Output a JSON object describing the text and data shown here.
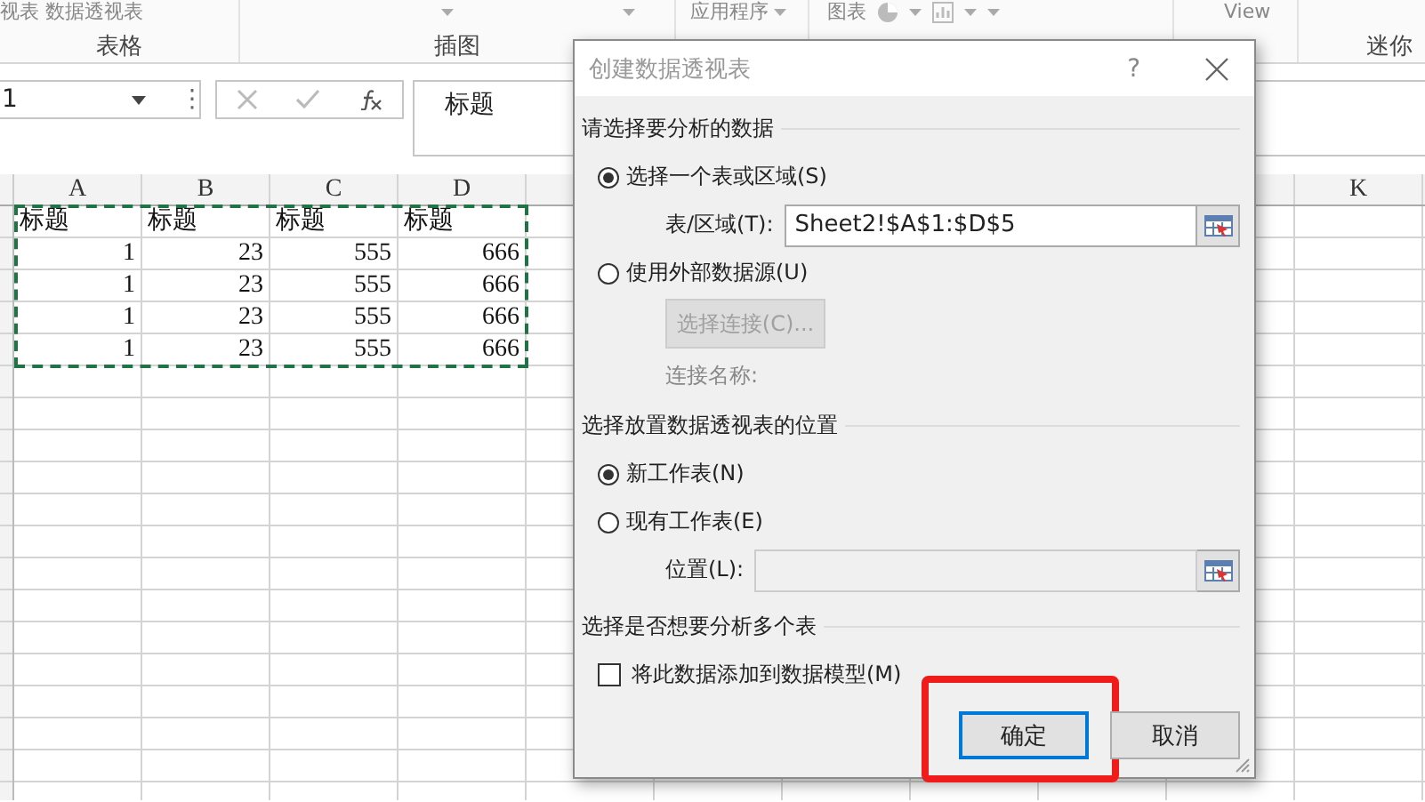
{
  "ribbon": {
    "groups": [
      {
        "label": "表格",
        "tools": [
          {
            "kind": "text",
            "text": "视表 数据透视表"
          }
        ]
      },
      {
        "label": "插图",
        "tools": [
          {
            "kind": "caret"
          },
          {
            "kind": "caret"
          }
        ]
      },
      {
        "tools": [
          {
            "kind": "text",
            "text": "应用程序"
          },
          {
            "kind": "caret"
          }
        ]
      },
      {
        "tools": [
          {
            "kind": "text",
            "text": "图表"
          },
          {
            "kind": "pie"
          },
          {
            "kind": "caret"
          },
          {
            "kind": "chart"
          },
          {
            "kind": "caret"
          },
          {
            "kind": "caret"
          }
        ]
      },
      {
        "tools": [
          {
            "kind": "text",
            "text": "View"
          }
        ]
      },
      {
        "label": "迷你"
      }
    ]
  },
  "formula_bar": {
    "name_box": "1",
    "more": "⋮",
    "formula": "标题"
  },
  "sheet": {
    "columns_left": [
      "A",
      "B",
      "C",
      "D"
    ],
    "columns_right": [
      "K"
    ],
    "copy_marquee": true,
    "rows": [
      {
        "kind": "text",
        "cells": [
          "标题",
          "标题",
          "标题",
          "标题"
        ]
      },
      {
        "kind": "number",
        "cells": [
          "1",
          "23",
          "555",
          "666"
        ]
      },
      {
        "kind": "number",
        "cells": [
          "1",
          "23",
          "555",
          "666"
        ]
      },
      {
        "kind": "number",
        "cells": [
          "1",
          "23",
          "555",
          "666"
        ]
      },
      {
        "kind": "number",
        "cells": [
          "1",
          "23",
          "555",
          "666"
        ]
      }
    ]
  },
  "dialog": {
    "title": "创建数据透视表",
    "help": "?",
    "sections": [
      {
        "heading": "请选择要分析的数据",
        "items": [
          {
            "kind": "radio",
            "label": "选择一个表或区域(S)",
            "selected": true
          },
          {
            "kind": "field",
            "label": "表/区域(T):",
            "value": "Sheet2!$A$1:$D$5",
            "disabled": false
          },
          {
            "kind": "radio",
            "label": "使用外部数据源(U)",
            "selected": false
          },
          {
            "kind": "button",
            "label": "选择连接(C)...",
            "disabled": true
          },
          {
            "kind": "note",
            "label": "连接名称:",
            "disabled": true
          }
        ]
      },
      {
        "heading": "选择放置数据透视表的位置",
        "items": [
          {
            "kind": "radio",
            "label": "新工作表(N)",
            "selected": true
          },
          {
            "kind": "radio",
            "label": "现有工作表(E)",
            "selected": false
          },
          {
            "kind": "field",
            "label": "位置(L):",
            "disabled": true
          }
        ]
      },
      {
        "heading": "选择是否想要分析多个表",
        "items": [
          {
            "kind": "checkbox",
            "label": "将此数据添加到数据模型(M)",
            "checked": false
          }
        ]
      }
    ],
    "buttons": [
      {
        "label": "确定",
        "default": true,
        "highlighted": true
      },
      {
        "label": "取消",
        "default": false,
        "highlighted": false
      }
    ]
  }
}
